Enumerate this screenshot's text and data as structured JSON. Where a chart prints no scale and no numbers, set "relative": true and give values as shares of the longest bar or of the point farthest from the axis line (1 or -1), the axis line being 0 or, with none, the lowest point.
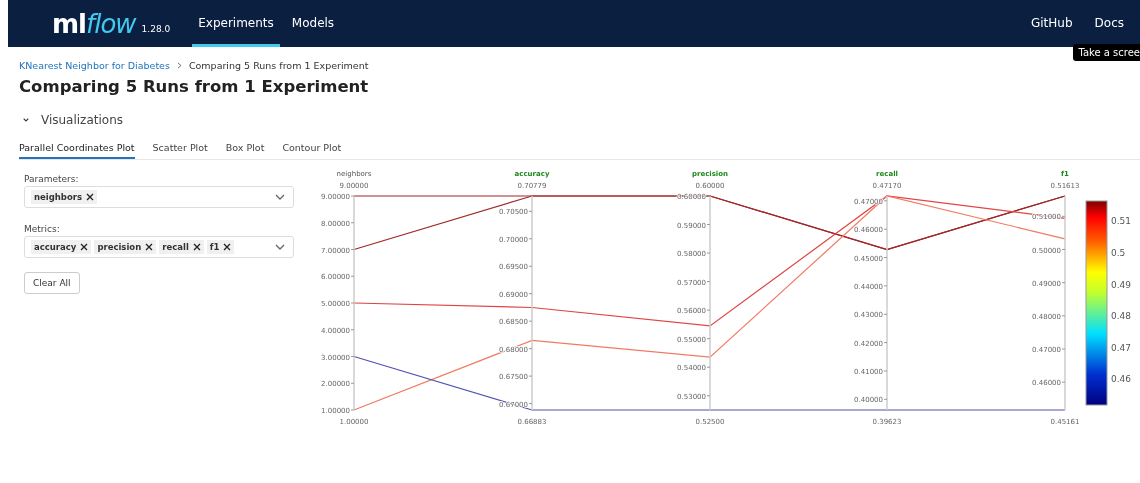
{
  "navbar": {
    "logo": {
      "plain": "ml",
      "accent": "flow"
    },
    "version": "1.28.0",
    "nav": [
      {
        "label": "Experiments",
        "selected": true
      },
      {
        "label": "Models",
        "selected": false
      }
    ],
    "links": [
      "GitHub",
      "Docs"
    ],
    "tooltip": "Take a scree"
  },
  "breadcrumb": [
    "KNearest Neighbor for Diabetes",
    "Comparing 5 Runs from 1 Experiment"
  ],
  "title": "Comparing 5 Runs from 1 Experiment",
  "section": {
    "label": "Visualizations",
    "expanded": true
  },
  "tabs": [
    {
      "label": "Parallel Coordinates Plot",
      "selected": true
    },
    {
      "label": "Scatter Plot",
      "selected": false
    },
    {
      "label": "Box Plot",
      "selected": false
    },
    {
      "label": "Contour Plot",
      "selected": false
    }
  ],
  "selectors": [
    {
      "label": "Parameters:",
      "tags": [
        "neighbors"
      ]
    },
    {
      "label": "Metrics:",
      "tags": [
        "accuracy",
        "precision",
        "recall",
        "f1"
      ]
    }
  ],
  "clear_button": "Clear All",
  "plot": {
    "axes": [
      {
        "kind": "parameter",
        "max": "9.00000",
        "min": "1.00000",
        "ticks": [
          "9.00000",
          "8.00000",
          "7.00000",
          "6.00000",
          "5.00000",
          "4.00000",
          "3.00000",
          "2.00000",
          "1.00000"
        ]
      },
      {
        "kind": "metric",
        "max": "0.70779",
        "min": "0.66883",
        "ticks": [
          "0.70500",
          "0.70000",
          "0.69500",
          "0.69000",
          "0.68500",
          "0.68000",
          "0.67500",
          "0.67000"
        ]
      },
      {
        "kind": "metric",
        "max": "0.60000",
        "min": "0.52500",
        "ticks": [
          "0.60000",
          "0.59000",
          "0.58000",
          "0.57000",
          "0.56000",
          "0.55000",
          "0.54000",
          "0.53000"
        ]
      },
      {
        "kind": "metric",
        "max": "0.47170",
        "min": "0.39623",
        "ticks": [
          "0.47000",
          "0.46000",
          "0.45000",
          "0.44000",
          "0.43000",
          "0.42000",
          "0.41000",
          "0.40000"
        ]
      },
      {
        "kind": "metric",
        "max": "0.51613",
        "min": "0.45161",
        "ticks": [
          "0.51000",
          "0.50000",
          "0.49000",
          "0.48000",
          "0.47000",
          "0.46000"
        ]
      }
    ],
    "colorbar_ticks": [
      "0.51",
      "0.5",
      "0.49",
      "0.48",
      "0.47",
      "0.46"
    ],
    "chart_data": {
      "type": "line",
      "relative": true,
      "grid": true,
      "categories": [
        "neighbors",
        "accuracy",
        "precision",
        "recall",
        "f1"
      ],
      "series": [
        {
          "color": "#a02828",
          "values": [
            1,
            1,
            1,
            0.75,
            1
          ]
        },
        {
          "color": "#a02828",
          "values": [
            0.75,
            1,
            1,
            0.75,
            1
          ]
        },
        {
          "color": "#e04444",
          "values": [
            0.5,
            0.479,
            0.393,
            1,
            0.896
          ]
        },
        {
          "color": "#f07a62",
          "values": [
            0,
            0.325,
            0.247,
            1,
            0.8
          ]
        },
        {
          "color": "#5252b0",
          "values": [
            0.25,
            0,
            0,
            0,
            0
          ]
        }
      ]
    }
  }
}
